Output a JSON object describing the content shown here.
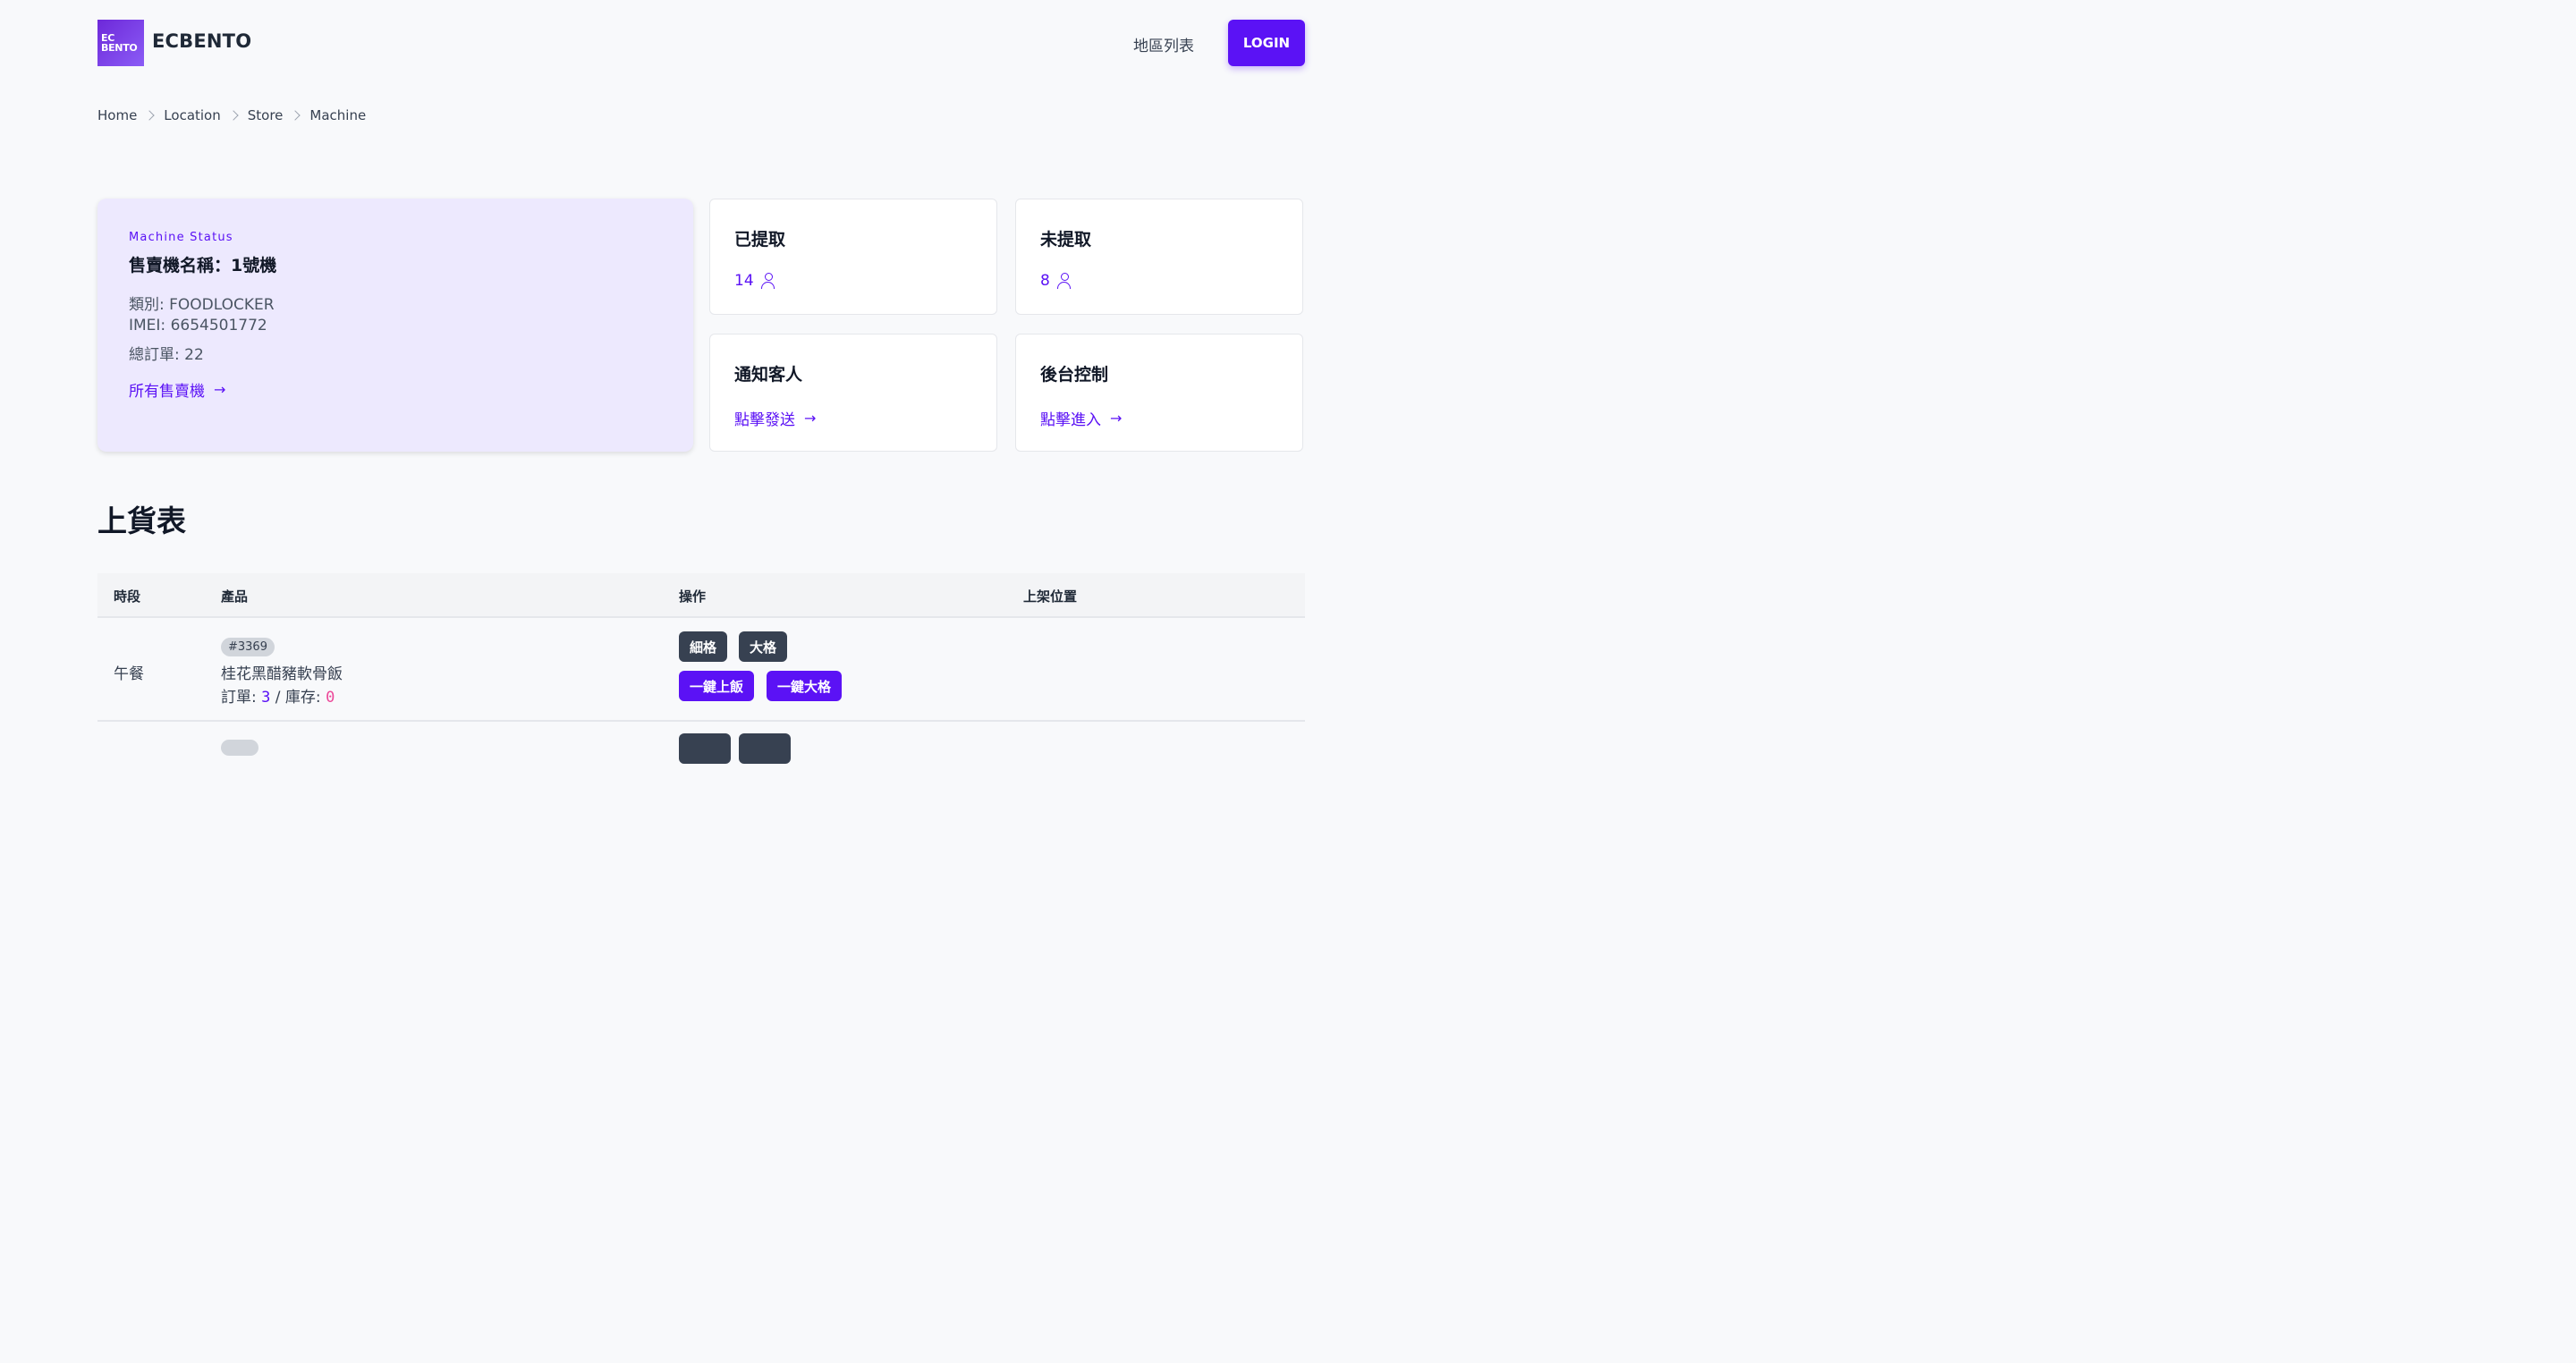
{
  "header": {
    "logo_line1": "EC",
    "logo_line2": "BENTO",
    "brand": "ECBENTO",
    "nav_link": "地區列表",
    "login": "LOGIN"
  },
  "breadcrumb": [
    "Home",
    "Location",
    "Store",
    "Machine"
  ],
  "status": {
    "label": "Machine Status",
    "name": "售賣機名稱：1號機",
    "category": "類別: FOODLOCKER",
    "imei": "IMEI: 6654501772",
    "total_orders": "總訂單: 22",
    "link": "所有售賣機"
  },
  "cards": {
    "picked_title": "已提取",
    "picked_value": "14",
    "unpicked_title": "未提取",
    "unpicked_value": "8",
    "notify_title": "通知客人",
    "notify_link": "點擊發送",
    "admin_title": "後台控制",
    "admin_link": "點擊進入"
  },
  "section_title": "上貨表",
  "table": {
    "headers": [
      "時段",
      "產品",
      "操作",
      "上架位置"
    ],
    "rows": [
      {
        "period": "午餐",
        "id": "#3369",
        "product": "桂花黑醋豬軟骨飯",
        "orders_label": "訂單:",
        "orders": "3",
        "stock_label": "/ 庫存:",
        "stock": "0",
        "actions": [
          "細格",
          "大格",
          "一鍵上飯",
          "一鍵大格"
        ]
      }
    ]
  },
  "colors": {
    "accent": "#5b12f5",
    "status_bg": "#ede9fe",
    "dark_button": "#374151",
    "stock_zero": "#ec4899"
  }
}
